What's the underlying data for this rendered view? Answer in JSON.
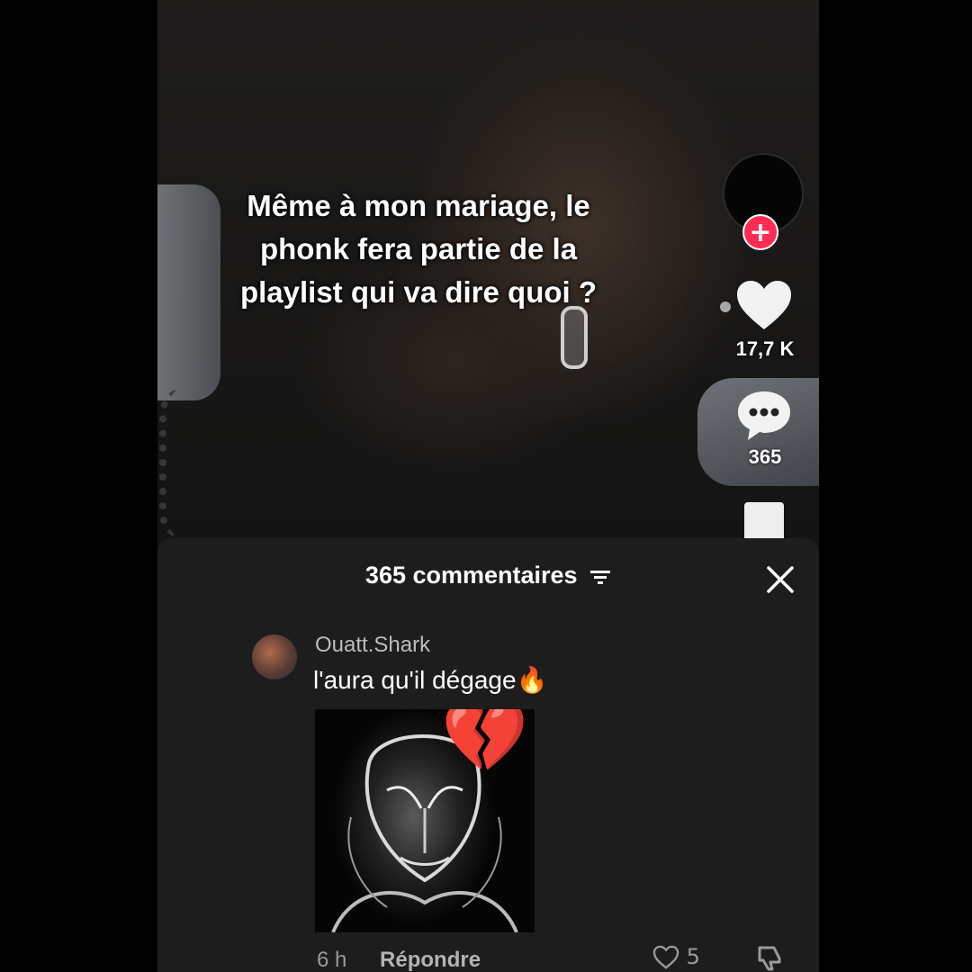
{
  "video": {
    "caption": "Même à mon mariage, le phonk fera partie de la playlist qui va dire quoi ?"
  },
  "actions": {
    "follow_icon": "plus-icon",
    "like_icon": "heart-icon",
    "like_count": "17,7 K",
    "comment_icon": "comment-bubble-icon",
    "comment_count": "365",
    "bookmark_icon": "bookmark-icon",
    "accent_color": "#fe2c55"
  },
  "comments_sheet": {
    "title": "365 commentaires",
    "filter_icon": "filter-icon",
    "close_icon": "close-icon",
    "comment": {
      "username": "Ouatt.Shark",
      "text": "l'aura qu'il dégage🔥",
      "sticker_emoji": "💔",
      "time": "6 h",
      "reply_label": "Répondre",
      "like_count": "5"
    }
  }
}
